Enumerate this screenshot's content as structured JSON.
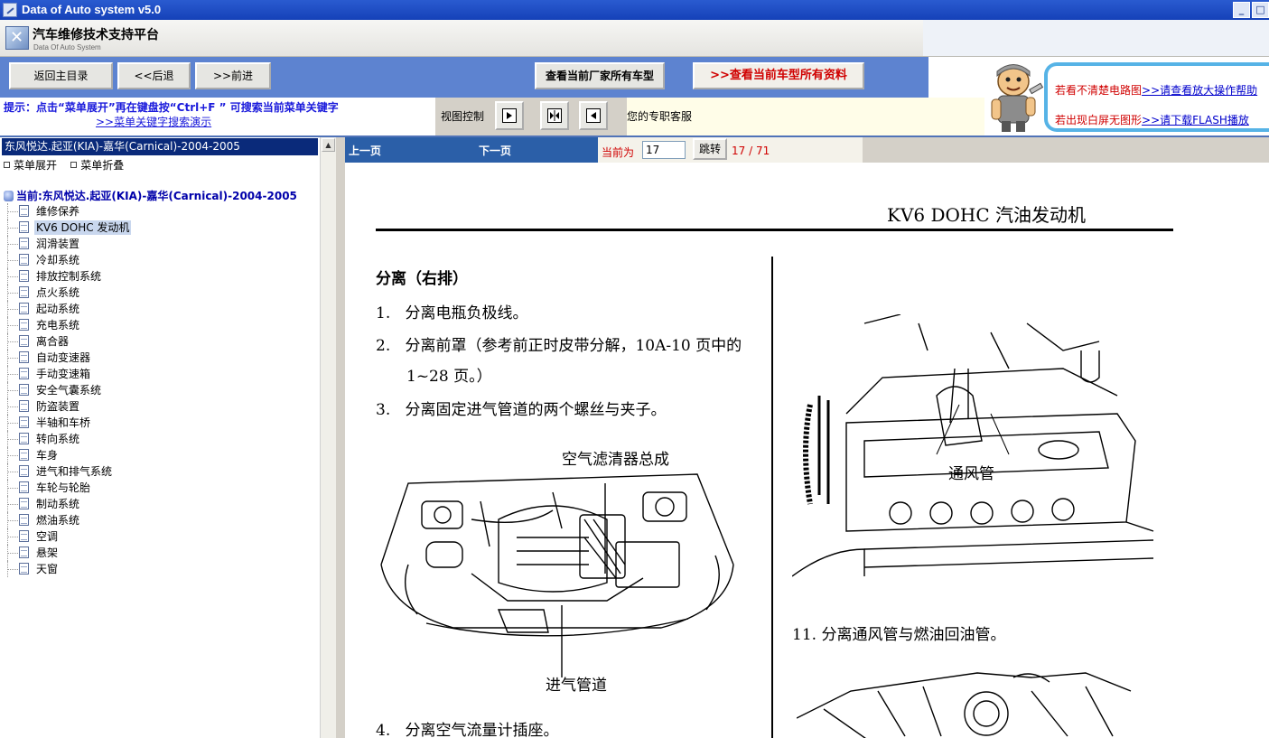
{
  "window": {
    "title": "Data of Auto system v5.0"
  },
  "logo": {
    "title_zh": "汽车维修技术支持平台",
    "title_en": "Data Of Auto System"
  },
  "toolbar": {
    "home": "返回主目录",
    "back": "<<后退",
    "forward": ">>前进",
    "maker_models": "查看当前厂家所有车型",
    "all_data": "查看当前车型所有资料"
  },
  "help": {
    "line1_prefix": "若看不清楚电路图",
    "line1_link": ">>请查看放大操作帮助",
    "line2_prefix": "若出现白屏无图形",
    "line2_link": ">>请下载FLASH播放"
  },
  "hint": {
    "text": "提示：点击“菜单展开”再在键盘按“Ctrl+F ” 可搜索当前菜单关键字",
    "demo_link": ">>菜单关键字搜索演示",
    "view_control_label": "视图控制",
    "customer_service": "您的专职客服"
  },
  "tree": {
    "car_header": "东风悦达.起亚(KIA)-嘉华(Carnical)-2004-2005",
    "expand": "菜单展开",
    "collapse": "菜单折叠",
    "current": "当前:东风悦达.起亚(KIA)-嘉华(Carnical)-2004-2005",
    "selected_index": 1,
    "items": [
      "维修保养",
      "KV6 DOHC 发动机",
      "润滑装置",
      "冷却系统",
      "排放控制系统",
      "点火系统",
      "起动系统",
      "充电系统",
      "离合器",
      "自动变速器",
      "手动变速箱",
      "安全气囊系统",
      "防盗装置",
      "半轴和车桥",
      "转向系统",
      "车身",
      "进气和排气系统",
      "车轮与轮胎",
      "制动系统",
      "燃油系统",
      "空调",
      "悬架",
      "天窗"
    ]
  },
  "pagenav": {
    "prev": "上一页",
    "next": "下一页",
    "current_label": "当前为",
    "current_page": "17",
    "jump": "跳转",
    "count": "17 / 71"
  },
  "document": {
    "header": "KV6 DOHC  汽油发动机",
    "section": "分离（右排）",
    "steps": [
      {
        "num": "1.",
        "text": "分离电瓶负极线。"
      },
      {
        "num": "2.",
        "text": "分离前罩（参考前正时皮带分解，10A-10 页中的"
      },
      {
        "num": "",
        "text": "1~28 页。）"
      },
      {
        "num": "3.",
        "text": "分离固定进气管道的两个螺丝与夹子。"
      },
      {
        "num": "4.",
        "text": "分离空气流量计插座。"
      }
    ],
    "label_air_filter": "空气滤清器总成",
    "label_intake": "进气管道",
    "label_vent": "通风管",
    "step11": "11.  分离通风管与燃油回油管。"
  }
}
